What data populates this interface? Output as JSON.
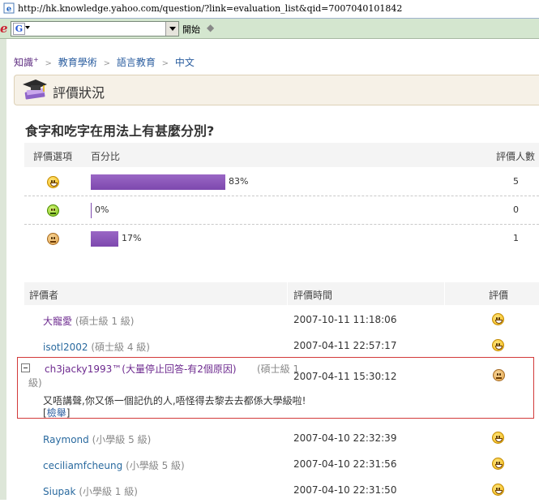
{
  "browser": {
    "url": "http://hk.knowledge.yahoo.com/question/?link=evaluation_list&qid=7007040101842",
    "search_value": "",
    "search_engine_icon": "G",
    "go_label": "開始"
  },
  "breadcrumb": {
    "root": "知識",
    "root_sup": "+",
    "items": [
      "教育學術",
      "語言教育",
      "中文"
    ]
  },
  "header": {
    "title": "評價狀況",
    "icon": "graduation-cap-icon"
  },
  "question": "食字和吃字在用法上有甚麼分別?",
  "stats": {
    "headers": {
      "option": "評價選項",
      "percent": "百分比",
      "count": "評價人數"
    },
    "rows": [
      {
        "face": "good",
        "percent": 83,
        "percent_label": "83%",
        "count": "5"
      },
      {
        "face": "neutral",
        "percent": 0,
        "percent_label": "0%",
        "count": "0"
      },
      {
        "face": "bad",
        "percent": 17,
        "percent_label": "17%",
        "count": "1"
      }
    ]
  },
  "reviewers": {
    "headers": {
      "name": "評價者",
      "time": "評價時間",
      "rating": "評價"
    },
    "rows": [
      {
        "name": "大寵愛",
        "level": "(碩士級 1 級)",
        "time": "2007-10-11 11:18:06",
        "face": "good",
        "visited": true
      },
      {
        "name": "isotl2002",
        "level": "(碩士級 4 級)",
        "time": "2007-04-11 22:57:17",
        "face": "good",
        "visited": false
      },
      {
        "name": "Raymond",
        "level": "(小學級 5 級)",
        "time": "2007-04-10 22:32:39",
        "face": "good",
        "visited": false
      },
      {
        "name": "ceciliamfcheung",
        "level": "(小學級 5 級)",
        "time": "2007-04-10 22:31:56",
        "face": "good",
        "visited": false
      },
      {
        "name": "Siupak",
        "level": "(小學級 1 級)",
        "time": "2007-04-10 22:31:50",
        "face": "good",
        "visited": false
      }
    ],
    "selected": {
      "name": "ch3jacky1993™(大量停止回答-有2個原因)",
      "level_part1": "(碩士級 1",
      "level_part2": "級)",
      "time": "2007-04-11 15:30:12",
      "face": "bad",
      "comment": "又唔講聲,你又係一個記仇的人,唔怪得去黎去去都係大學級啦!",
      "report_open": "[",
      "report_label": "檢舉",
      "report_close": "]"
    }
  }
}
